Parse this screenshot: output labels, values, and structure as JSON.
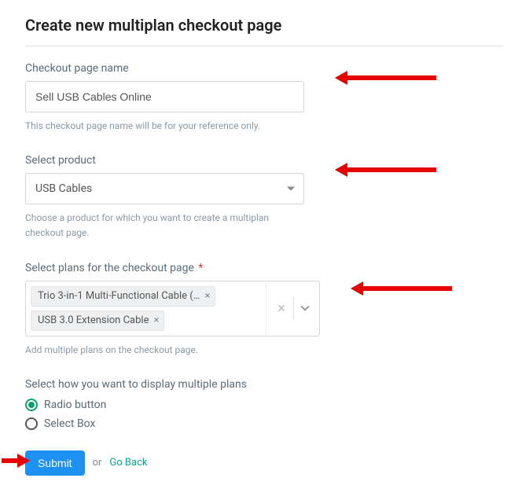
{
  "title": "Create new multiplan checkout page",
  "fields": {
    "name": {
      "label": "Checkout page name",
      "value": "Sell USB Cables Online",
      "helper": "This checkout page name will be for your reference only."
    },
    "product": {
      "label": "Select product",
      "value": "USB Cables",
      "helper": "Choose a product for which you want to create a multiplan checkout page."
    },
    "plans": {
      "label": "Select plans for the checkout page",
      "required_mark": "*",
      "chips": [
        "Trio 3-in-1 Multi-Functional Cable (…",
        "USB 3.0 Extension Cable"
      ],
      "helper": "Add multiple plans on the checkout page."
    },
    "display": {
      "label": "Select how you want to display multiple plans",
      "options": [
        "Radio button",
        "Select Box"
      ],
      "selected_index": 0
    }
  },
  "actions": {
    "submit": "Submit",
    "or": "or",
    "goback": "Go Back"
  }
}
